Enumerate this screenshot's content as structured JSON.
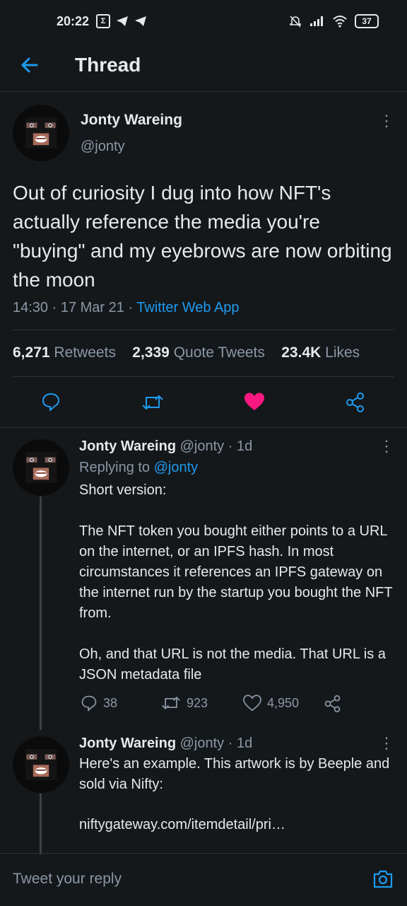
{
  "status_bar": {
    "time": "20:22",
    "battery": "37"
  },
  "header": {
    "title": "Thread"
  },
  "main_tweet": {
    "name": "Jonty Wareing",
    "handle": "@jonty",
    "text": "Out of curiosity I dug into how NFT's actually reference the media you're \"buying\" and my eyebrows are now orbiting the moon",
    "timestamp": "14:30 · 17 Mar 21 · ",
    "source": "Twitter Web App",
    "retweets_count": "6,271",
    "retweets_label": "Retweets",
    "quotes_count": "2,339",
    "quotes_label": "Quote Tweets",
    "likes_count": "23.4K",
    "likes_label": "Likes",
    "liked": true,
    "like_color": "#f91880"
  },
  "replies": [
    {
      "name": "Jonty Wareing",
      "handle": "@jonty",
      "age": "· 1d",
      "replying_prefix": "Replying to ",
      "replying_to": "@jonty",
      "paragraphs": [
        "Short version:",
        "The NFT token you bought either points to a URL on the internet, or an IPFS hash. In most circumstances it references an IPFS gateway on the internet run by the startup you bought the NFT from.",
        "Oh, and that URL is not the media. That URL is a JSON metadata file"
      ],
      "reply_count": "38",
      "retweet_count": "923",
      "like_count": "4,950"
    },
    {
      "name": "Jonty Wareing",
      "handle": "@jonty",
      "age": "· 1d",
      "text": "Here's an example. This artwork is by Beeple and sold via Nifty:",
      "link": "niftygateway.com/itemdetail/pri…"
    }
  ],
  "composer": {
    "placeholder": "Tweet your reply"
  },
  "colors": {
    "background": "#15181b",
    "accent": "#1d9bf0",
    "muted": "#8b98a5"
  }
}
